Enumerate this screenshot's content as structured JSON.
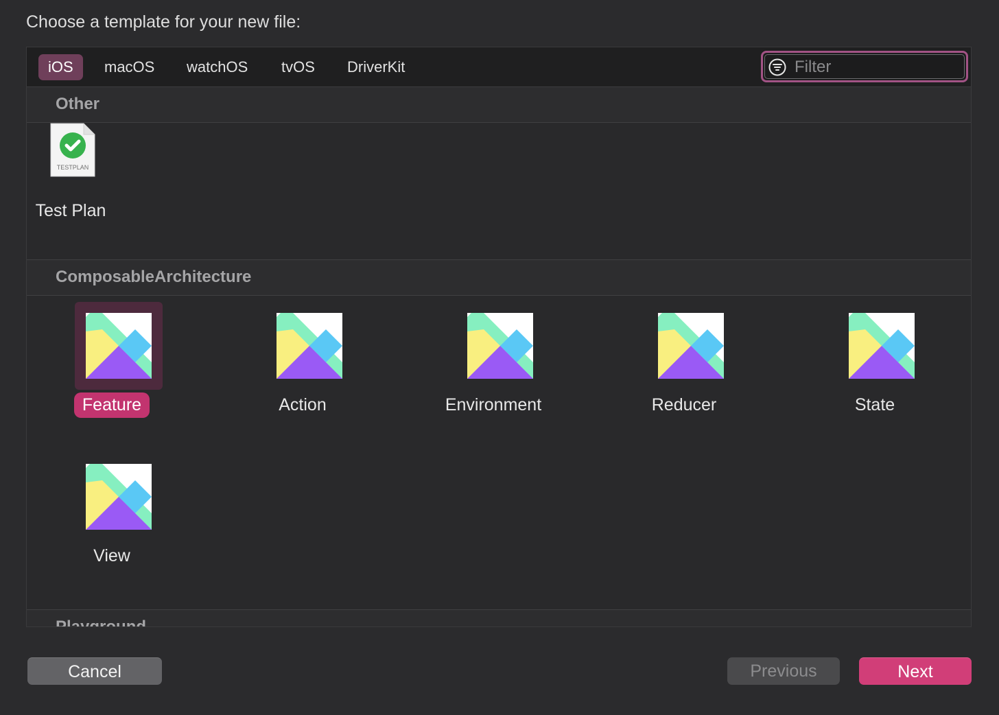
{
  "dialog": {
    "heading": "Choose a template for your new file:"
  },
  "tabs": [
    {
      "label": "iOS",
      "active": true
    },
    {
      "label": "macOS",
      "active": false
    },
    {
      "label": "watchOS",
      "active": false
    },
    {
      "label": "tvOS",
      "active": false
    },
    {
      "label": "DriverKit",
      "active": false
    }
  ],
  "filter": {
    "placeholder": "Filter",
    "value": "",
    "icon": "filter-icon"
  },
  "sections": [
    {
      "title": "Other",
      "items": [
        {
          "label": "Test Plan",
          "icon": "testplan-file-icon",
          "icon_caption": "TESTPLAN"
        }
      ]
    },
    {
      "title": "ComposableArchitecture",
      "items": [
        {
          "label": "Feature",
          "icon": "tca-icon",
          "selected": true
        },
        {
          "label": "Action",
          "icon": "tca-icon",
          "selected": false
        },
        {
          "label": "Environment",
          "icon": "tca-icon",
          "selected": false
        },
        {
          "label": "Reducer",
          "icon": "tca-icon",
          "selected": false
        },
        {
          "label": "State",
          "icon": "tca-icon",
          "selected": false
        },
        {
          "label": "View",
          "icon": "tca-icon",
          "selected": false
        }
      ]
    },
    {
      "title": "Playground"
    }
  ],
  "buttons": {
    "cancel": "Cancel",
    "previous": "Previous",
    "next": "Next"
  },
  "colors": {
    "accent": "#d13e78",
    "selection_bg": "#4d2a3d",
    "tab_active": "#6f3f5a"
  }
}
